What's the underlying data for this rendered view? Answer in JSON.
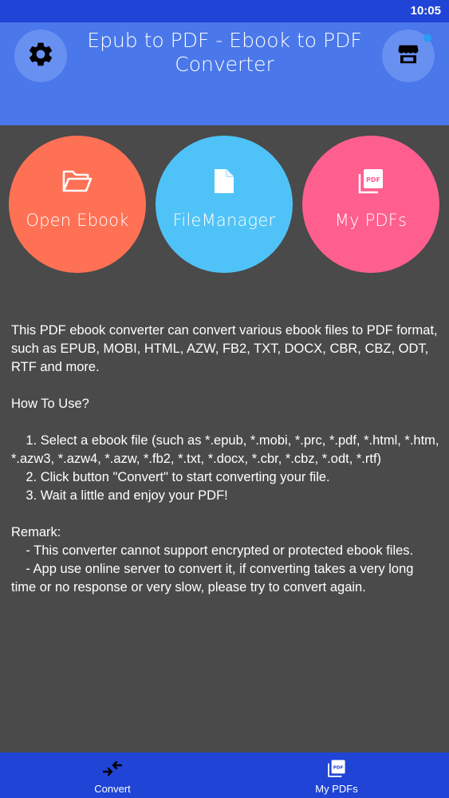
{
  "status_bar": {
    "time": "10:05"
  },
  "header": {
    "title": "Epub to PDF - Ebook to PDF Converter",
    "settings_icon": "gear-icon",
    "store_icon": "store-icon",
    "colors": {
      "header": "#4a78ea",
      "status": "#1f44d6"
    }
  },
  "actions": [
    {
      "label": "Open Ebook",
      "icon": "folder-open-icon",
      "color": "#ff7155"
    },
    {
      "label": "FileManager",
      "icon": "file-icon",
      "color": "#4fc3f7"
    },
    {
      "label": "My PDFs",
      "icon": "pdf-icon",
      "color": "#fe5f8f"
    }
  ],
  "description": {
    "text": "This PDF ebook converter can convert various ebook files to PDF format, such as EPUB, MOBI, HTML, AZW, FB2, TXT, DOCX, CBR, CBZ, ODT, RTF and more.\n\nHow To Use?\n\n    1. Select a ebook file (such as *.epub, *.mobi, *.prc, *.pdf, *.html, *.htm, *.azw3, *.azw4, *.azw, *.fb2, *.txt, *.docx, *.cbr, *.cbz, *.odt, *.rtf)\n    2. Click button \"Convert\" to start converting your file.\n    3. Wait a little and enjoy your PDF!\n\nRemark:\n    - This converter cannot support encrypted or protected ebook files.\n    - App use online server to convert it, if converting takes a very long time or no response or very slow, please try to convert again."
  },
  "bottom_nav": {
    "items": [
      {
        "label": "Convert",
        "icon": "convert-arrows-icon"
      },
      {
        "label": "My PDFs",
        "icon": "pdf-icon"
      }
    ]
  }
}
